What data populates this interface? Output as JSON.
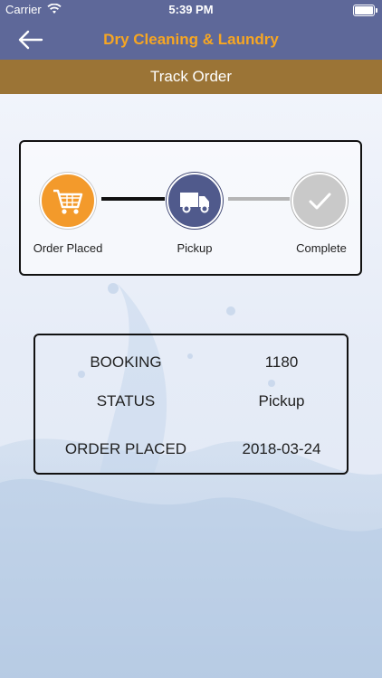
{
  "status_bar": {
    "carrier": "Carrier",
    "time": "5:39 PM"
  },
  "nav": {
    "title": "Dry Cleaning & Laundry",
    "back_icon": "arrow-left-icon"
  },
  "subheader": {
    "title": "Track Order"
  },
  "tracking": {
    "steps": [
      {
        "label": "Order Placed",
        "icon": "cart-icon",
        "color": "#f39a2b",
        "state": "done"
      },
      {
        "label": "Pickup",
        "icon": "truck-icon",
        "color": "#505a8c",
        "state": "current"
      },
      {
        "label": "Complete",
        "icon": "check-icon",
        "color": "#c9c9c9",
        "state": "pending"
      }
    ]
  },
  "order_info": {
    "rows": [
      {
        "key": "BOOKING",
        "value": "1180"
      },
      {
        "key": "STATUS",
        "value": "Pickup"
      },
      {
        "key": "ORDER PLACED",
        "value": "2018-03-24"
      }
    ]
  },
  "colors": {
    "nav_bg": "#5e6899",
    "title_accent": "#f6a623",
    "subbar_bg": "#9b7436"
  }
}
